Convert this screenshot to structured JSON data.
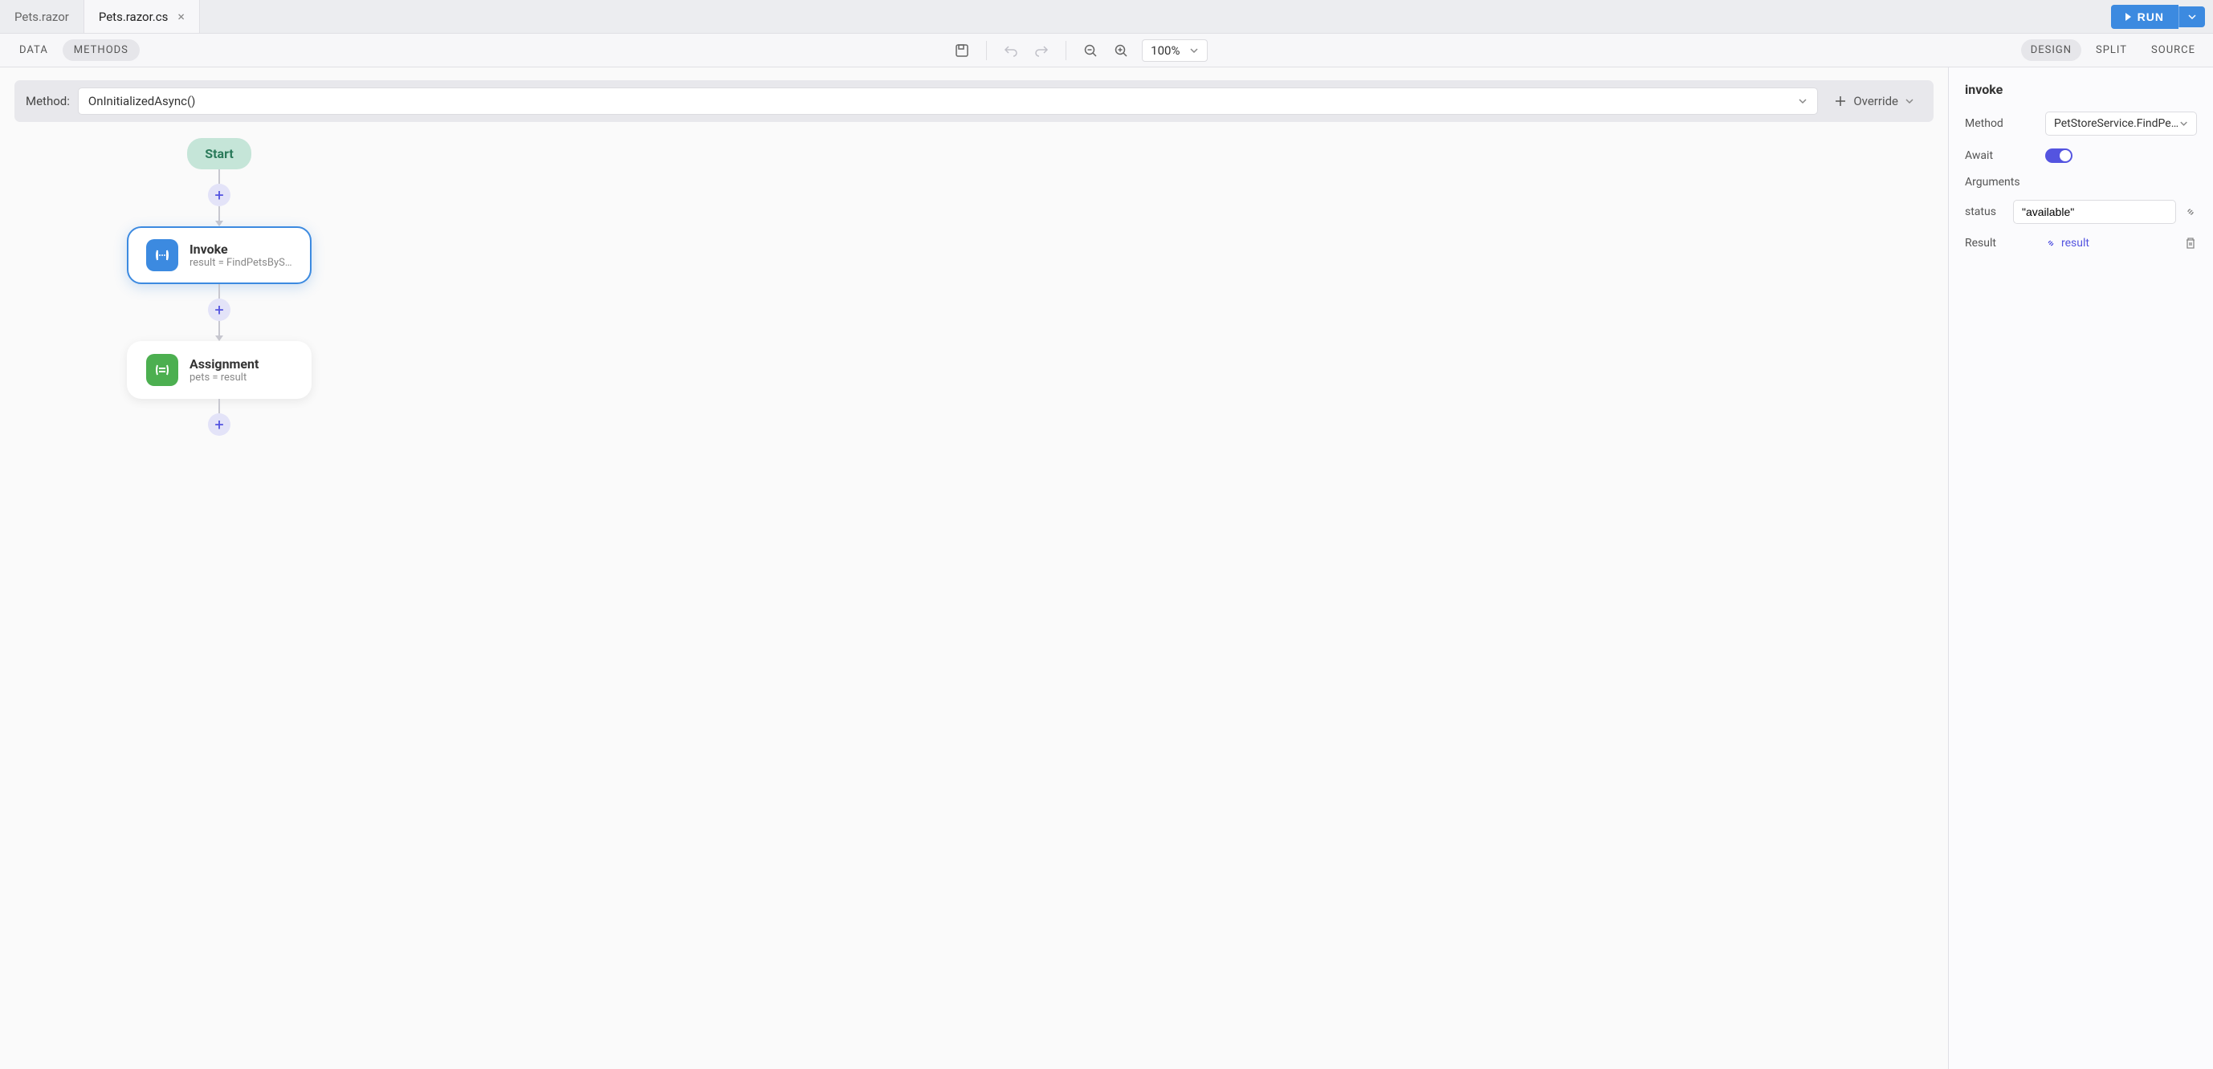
{
  "tabs": [
    {
      "label": "Pets.razor",
      "active": false,
      "closable": false
    },
    {
      "label": "Pets.razor.cs",
      "active": true,
      "closable": true
    }
  ],
  "run_button": {
    "label": "RUN"
  },
  "subnav": {
    "data_label": "DATA",
    "methods_label": "METHODS"
  },
  "zoom": {
    "value": "100%"
  },
  "view_tabs": {
    "design": "DESIGN",
    "split": "SPLIT",
    "source": "SOURCE"
  },
  "method_bar": {
    "label": "Method:",
    "value": "OnInitializedAsync()",
    "override_label": "Override"
  },
  "flow": {
    "start_label": "Start",
    "invoke": {
      "title": "Invoke",
      "sub": "result = FindPetsByS…"
    },
    "assignment": {
      "title": "Assignment",
      "sub": "pets = result"
    }
  },
  "props": {
    "title": "invoke",
    "method": {
      "label": "Method",
      "value": "PetStoreService.FindPets…"
    },
    "await": {
      "label": "Await",
      "on": true
    },
    "arguments_label": "Arguments",
    "status": {
      "label": "status",
      "value": "\"available\""
    },
    "result": {
      "label": "Result",
      "link_text": "result"
    }
  }
}
